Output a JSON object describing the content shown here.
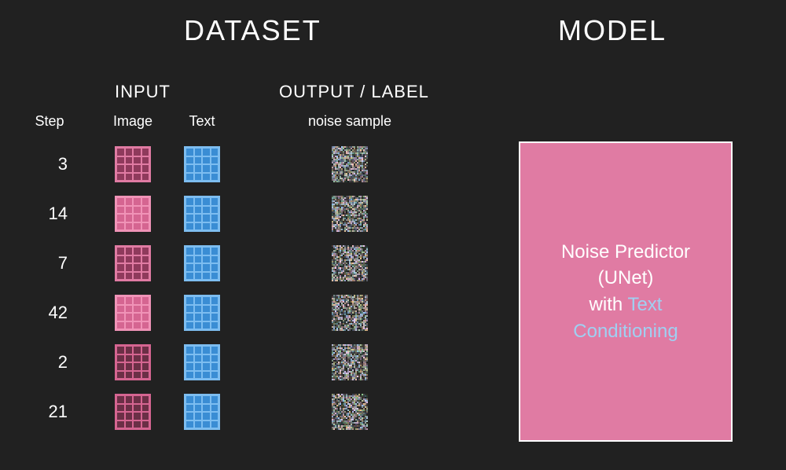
{
  "headings": {
    "dataset": "DATASET",
    "model": "MODEL",
    "input": "INPUT",
    "output": "OUTPUT  / LABEL"
  },
  "columns": {
    "step": "Step",
    "image": "Image",
    "text": "Text",
    "noise": "noise sample"
  },
  "rows": [
    {
      "step": "3",
      "imageColor": "mid"
    },
    {
      "step": "14",
      "imageColor": "light"
    },
    {
      "step": "7",
      "imageColor": "mid"
    },
    {
      "step": "42",
      "imageColor": "light"
    },
    {
      "step": "2",
      "imageColor": "dark"
    },
    {
      "step": "21",
      "imageColor": "dark"
    }
  ],
  "model": {
    "line1": "Noise Predictor",
    "line2": "(UNet)",
    "line3": "with",
    "line4a": "Text",
    "line4b": "Conditioning"
  },
  "palette": {
    "image": {
      "dark": {
        "border": "#d56591",
        "fill": "#6b2f46"
      },
      "mid": {
        "border": "#e07ba3",
        "fill": "#8f3a5c"
      },
      "light": {
        "border": "#f093b7",
        "fill": "#d56591"
      }
    },
    "text": {
      "border": "#7dbdf0",
      "fill": "#3a8dd4"
    },
    "modelBg": "#e07ba3"
  },
  "layout": {
    "rowStartY": 186,
    "rowGap": 63,
    "stepX": 38,
    "imageX": 146,
    "textX": 234,
    "noiseX": 422
  }
}
